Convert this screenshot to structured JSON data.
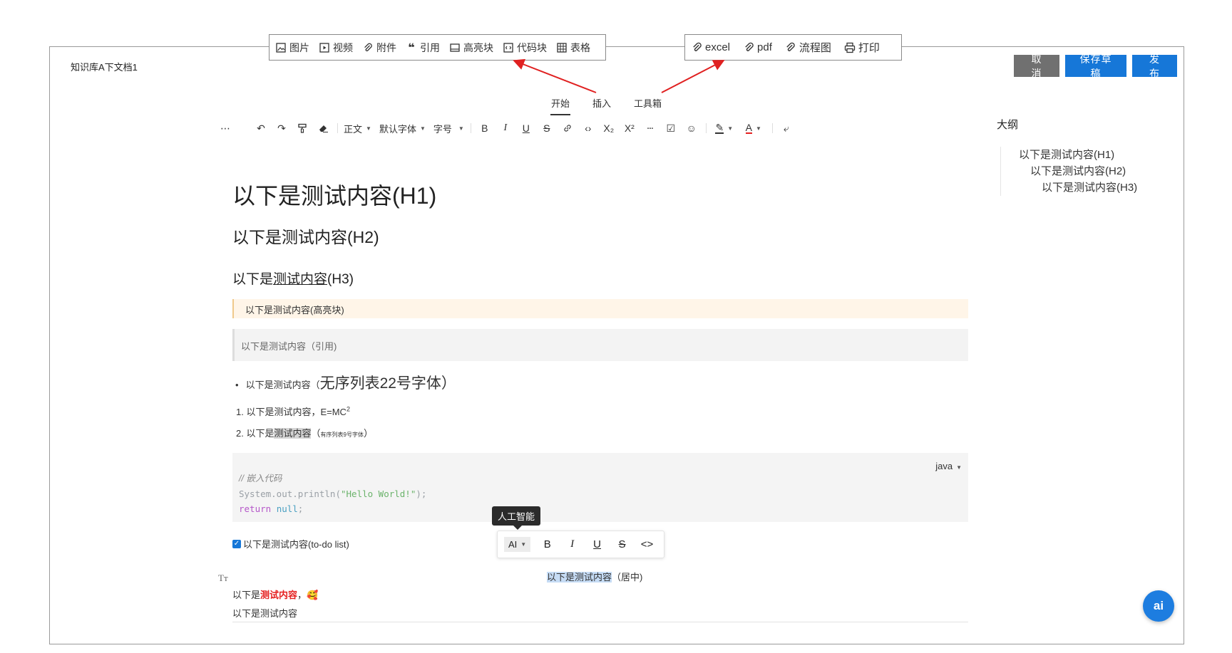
{
  "document": {
    "title": "知识库A下文档1"
  },
  "actions": {
    "cancel": "取 消",
    "save_draft": "保存草稿",
    "publish": "发 布"
  },
  "insert_callout": [
    {
      "label": "图片",
      "icon": "image-icon"
    },
    {
      "label": "视频",
      "icon": "video-icon"
    },
    {
      "label": "附件",
      "icon": "paperclip-icon"
    },
    {
      "label": "引用",
      "icon": "quote-icon"
    },
    {
      "label": "高亮块",
      "icon": "highlight-block-icon"
    },
    {
      "label": "代码块",
      "icon": "code-block-icon"
    },
    {
      "label": "表格",
      "icon": "table-icon"
    }
  ],
  "tools_callout": [
    {
      "label": "excel",
      "icon": "paperclip-icon"
    },
    {
      "label": "pdf",
      "icon": "paperclip-icon"
    },
    {
      "label": "流程图",
      "icon": "paperclip-icon"
    },
    {
      "label": "打印",
      "icon": "printer-icon"
    }
  ],
  "tabs": [
    {
      "label": "开始",
      "active": true
    },
    {
      "label": "插入",
      "active": false
    },
    {
      "label": "工具箱",
      "active": false
    }
  ],
  "toolbar": {
    "paragraph_style": "正文",
    "font_family": "默认字体",
    "font_size": "字号",
    "bold": "B",
    "italic": "I",
    "underline": "U",
    "strike": "S",
    "subscript": "X₂",
    "superscript": "X²",
    "font_color": "A"
  },
  "outline": {
    "title": "大纲",
    "items": [
      {
        "label": "以下是测试内容(H1)",
        "level": 1
      },
      {
        "label": "以下是测试内容(H2)",
        "level": 2
      },
      {
        "label": "以下是测试内容(H3)",
        "level": 3
      }
    ]
  },
  "content": {
    "h1": "以下是测试内容(H1)",
    "h2": "以下是测试内容(H2)",
    "h3_prefix": "以下是",
    "h3_underlined": "测试内容",
    "h3_suffix": "(H3)",
    "highlight": "以下是测试内容(高亮块)",
    "quote": "以下是测试内容（引用)",
    "bullet_text": "以下是测试内容（",
    "bullet_big": "无序列表22号字体）",
    "ol1_text": "1. 以下是测试内容，E=MC",
    "ol1_sup": "2",
    "ol2_prefix": "2. 以下是",
    "ol2_gray": "测试内容",
    "ol2_paren_open": "（",
    "ol2_tiny": "有序列表9号字体",
    "ol2_paren_close": "）",
    "code": {
      "lang": "java",
      "comment": "// 嵌入代码",
      "line2_prefix": "System.out.println(",
      "line2_string": "\"Hello World!\"",
      "line2_suffix": ");",
      "line3_kw": "return",
      "line3_null": "null",
      "line3_end": ";"
    },
    "todo": "以下是测试内容(to-do list)",
    "centered_selected": "以下是测试内容",
    "centered_rest": "（居中)",
    "red_prefix": "以下是",
    "red_text": "测试内容",
    "red_after": "，",
    "emoji": "🥰",
    "last_line": "以下是测试内容"
  },
  "bubble": {
    "tooltip": "人工智能",
    "ai_label": "AI",
    "bold": "B",
    "italic": "I",
    "underline": "U",
    "strike": "S",
    "code": "<>"
  },
  "fab": {
    "label": "ai"
  },
  "colors": {
    "primary": "#1677d8",
    "cancel": "#707070",
    "arrow": "#e02020",
    "highlight_bg": "#fff5e8",
    "selection": "#c6dcf5"
  }
}
